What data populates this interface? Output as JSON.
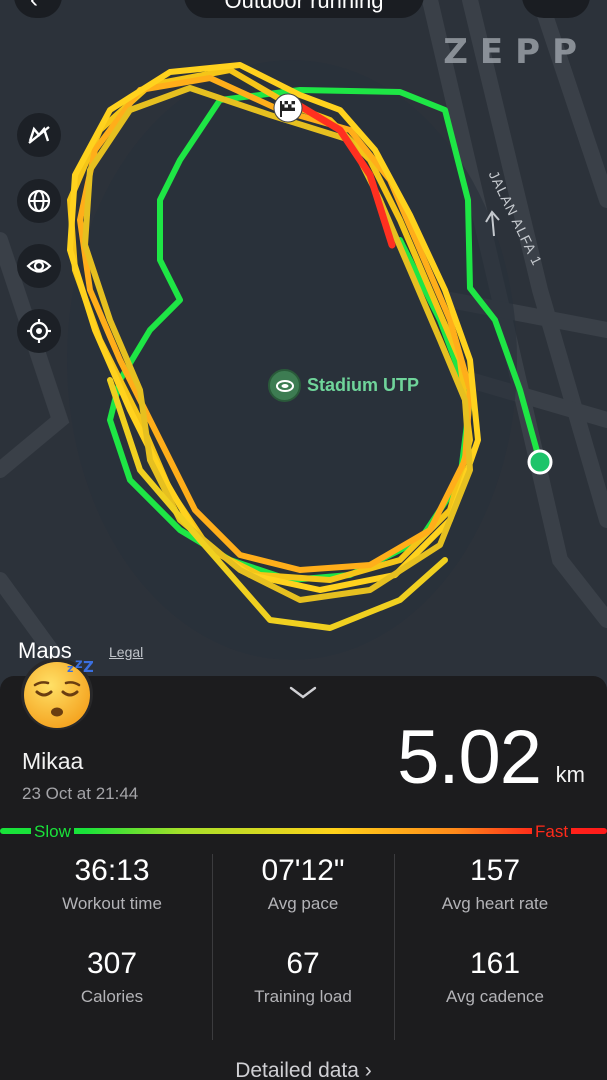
{
  "header": {
    "title": "Outdoor running"
  },
  "map": {
    "brand": "ZEPP",
    "road_label": "JALAN ALFA 1",
    "poi_label": "Stadium UTP",
    "attribution": "Maps",
    "legal": "Legal",
    "controls": [
      {
        "icon": "map-3d-off-icon"
      },
      {
        "icon": "globe-icon"
      },
      {
        "icon": "eye-icon"
      },
      {
        "icon": "locate-icon"
      }
    ]
  },
  "summary": {
    "user_name": "Mikaa",
    "date": "23 Oct at 21:44",
    "distance_value": "5.02",
    "distance_unit": "km",
    "pace_slow_label": "Slow",
    "pace_fast_label": "Fast"
  },
  "stats": [
    {
      "value": "36:13",
      "label": "Workout time"
    },
    {
      "value": "07'12\"",
      "label": "Avg pace"
    },
    {
      "value": "157",
      "label": "Avg heart rate"
    },
    {
      "value": "307",
      "label": "Calories"
    },
    {
      "value": "67",
      "label": "Training load"
    },
    {
      "value": "161",
      "label": "Avg cadence"
    }
  ],
  "footer": {
    "detail_label": "Detailed data"
  },
  "colors": {
    "slow": "#19e23a",
    "fast": "#ff2a1a",
    "background": "#1c1c1e",
    "map": "#2c323a"
  }
}
